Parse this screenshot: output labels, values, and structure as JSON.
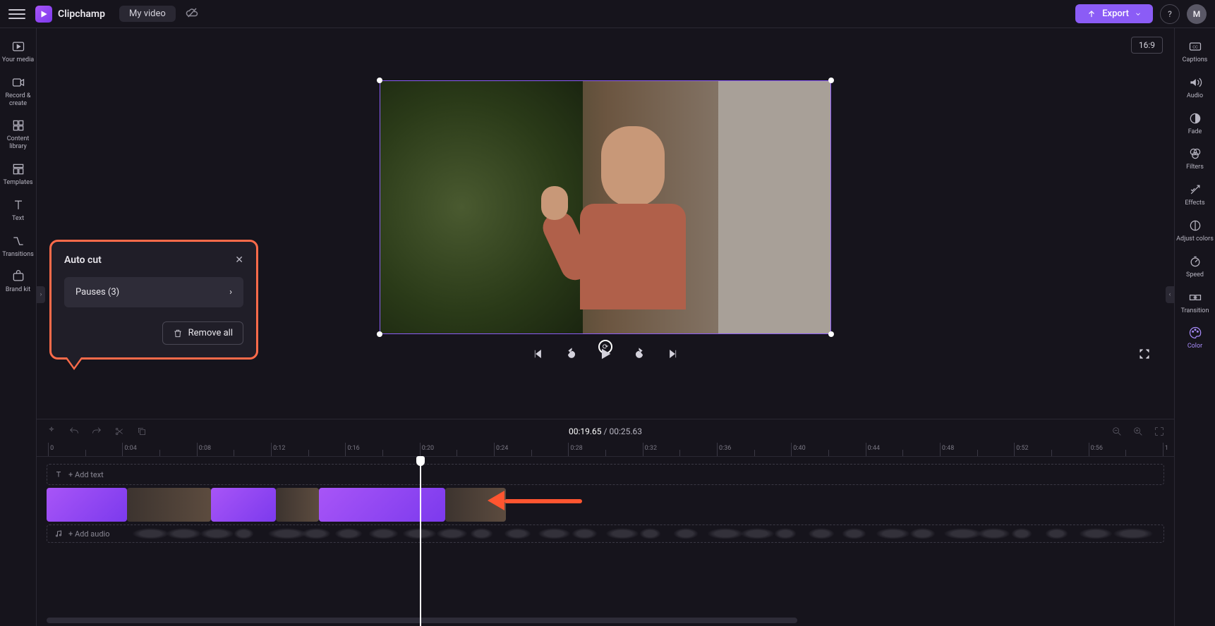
{
  "header": {
    "brand": "Clipchamp",
    "project_title": "My video",
    "export_label": "Export",
    "avatar_letter": "M",
    "aspect_ratio": "16:9"
  },
  "left_rail": [
    {
      "id": "your-media",
      "label": "Your media"
    },
    {
      "id": "record-create",
      "label": "Record & create"
    },
    {
      "id": "content-library",
      "label": "Content library"
    },
    {
      "id": "templates",
      "label": "Templates"
    },
    {
      "id": "text",
      "label": "Text"
    },
    {
      "id": "transitions",
      "label": "Transitions"
    },
    {
      "id": "brand-kit",
      "label": "Brand kit"
    }
  ],
  "right_rail": [
    {
      "id": "captions",
      "label": "Captions"
    },
    {
      "id": "audio",
      "label": "Audio"
    },
    {
      "id": "fade",
      "label": "Fade"
    },
    {
      "id": "filters",
      "label": "Filters"
    },
    {
      "id": "effects",
      "label": "Effects"
    },
    {
      "id": "adjust-colors",
      "label": "Adjust colors"
    },
    {
      "id": "speed",
      "label": "Speed"
    },
    {
      "id": "transition",
      "label": "Transition"
    },
    {
      "id": "color",
      "label": "Color"
    }
  ],
  "autocut": {
    "title": "Auto cut",
    "pauses_label": "Pauses (3)",
    "remove_all_label": "Remove all"
  },
  "playback": {
    "current_time": "00:19.65",
    "separator": "/",
    "total_time": "00:25.63"
  },
  "ruler": [
    "0",
    "0:04",
    "0:08",
    "0:12",
    "0:16",
    "0:20",
    "0:24",
    "0:28",
    "0:32",
    "0:36",
    "0:40",
    "0:44",
    "0:48",
    "0:52",
    "0:56",
    "1"
  ],
  "tracks": {
    "add_text_label": "+ Add text",
    "add_audio_label": "+ Add audio"
  },
  "clips": [
    {
      "type": "purple",
      "start_pct": 0,
      "width_pct": 7.2
    },
    {
      "type": "video",
      "start_pct": 7.2,
      "width_pct": 7.5
    },
    {
      "type": "purple",
      "start_pct": 14.7,
      "width_pct": 5.8
    },
    {
      "type": "video",
      "start_pct": 20.5,
      "width_pct": 3.9
    },
    {
      "type": "purple",
      "start_pct": 24.4,
      "width_pct": 11.3
    },
    {
      "type": "video",
      "start_pct": 35.7,
      "width_pct": 5.4
    }
  ],
  "playhead_pct": 32.8,
  "colors": {
    "accent": "#8b5cf6",
    "highlight": "#ff6b4a",
    "arrow": "#ff5530"
  }
}
